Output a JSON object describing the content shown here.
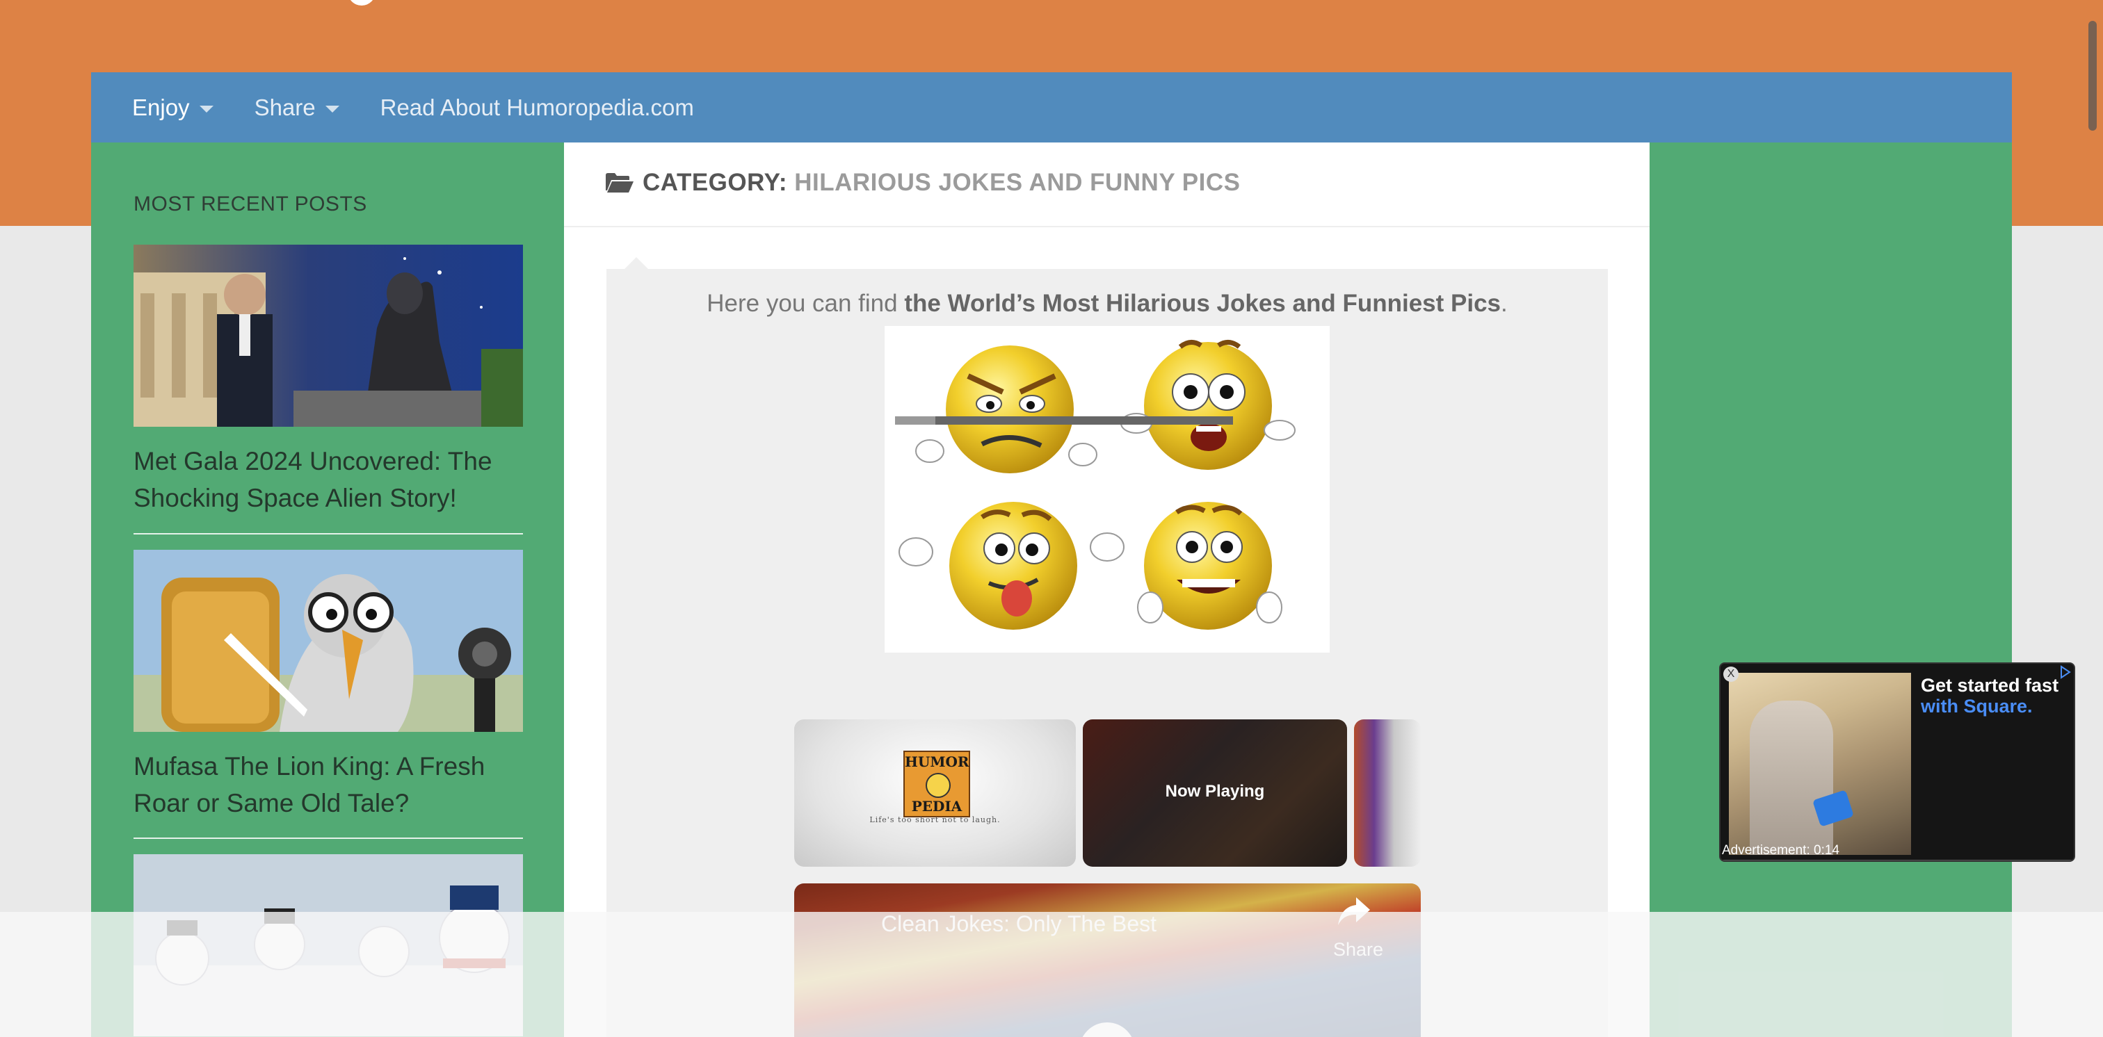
{
  "nav": {
    "items": [
      {
        "label": "Enjoy"
      },
      {
        "label": "Share"
      },
      {
        "label": "Read About Humoropedia.com"
      }
    ]
  },
  "sidebar": {
    "widget_title": "MOST RECENT POSTS",
    "posts": [
      {
        "title": "Met Gala 2024 Uncovered: The Shocking Space Alien Story!"
      },
      {
        "title": "Mufasa The Lion King: A Fresh Roar or Same Old Tale?"
      }
    ]
  },
  "main": {
    "category_prefix": "CATEGORY:",
    "category_name": "HILARIOUS JOKES AND FUNNY PICS",
    "description_lead": "Here you can find ",
    "description_bold": "the World’s Most Hilarious Jokes and Funniest Pics",
    "description_tail": "."
  },
  "video": {
    "logo_lines": [
      "HUMOR",
      "PEDIA"
    ],
    "logo_tagline": "Life's too short not to laugh.",
    "now_playing": "Now Playing",
    "player_title": "Clean Jokes: Only The Best",
    "share_label": "Share",
    "progress_fraction": 0.12
  },
  "ad": {
    "close": "X",
    "headline_line1": "Get started fast",
    "headline_line2": "with Square.",
    "timer": "Advertisement: 0:14"
  },
  "colors": {
    "top_band": "#dd8245",
    "navbar": "#518bbd",
    "sidebar_green": "#52aa74",
    "ad_accent": "#4a8df5"
  }
}
